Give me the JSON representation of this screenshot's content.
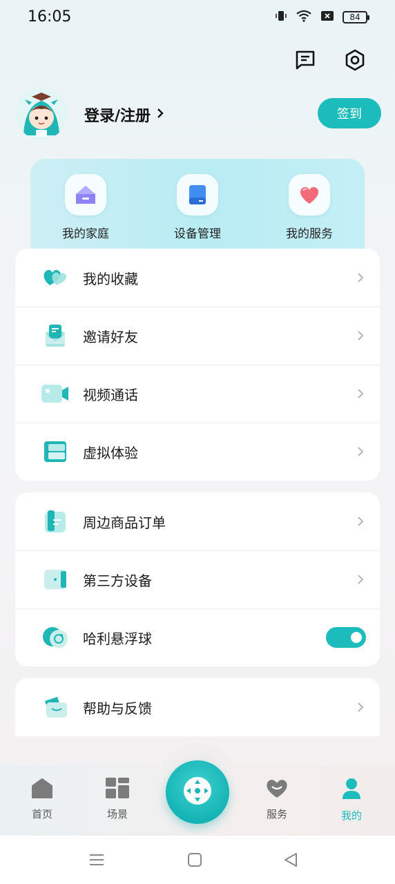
{
  "status_bar": {
    "time": "16:05",
    "battery": "84"
  },
  "header": {
    "message_icon": "message-icon",
    "settings_icon": "settings-icon"
  },
  "profile": {
    "login_label": "登录/注册",
    "checkin_label": "签到"
  },
  "quick_actions": [
    {
      "label": "我的家庭",
      "icon": "home-icon"
    },
    {
      "label": "设备管理",
      "icon": "device-icon"
    },
    {
      "label": "我的服务",
      "icon": "heart-icon"
    }
  ],
  "menu_group_1": [
    {
      "label": "我的收藏",
      "icon": "favorite-icon"
    },
    {
      "label": "邀请好友",
      "icon": "invite-icon"
    },
    {
      "label": "视频通话",
      "icon": "video-call-icon"
    },
    {
      "label": "虚拟体验",
      "icon": "virtual-experience-icon"
    }
  ],
  "menu_group_2": [
    {
      "label": "周边商品订单",
      "icon": "order-icon"
    },
    {
      "label": "第三方设备",
      "icon": "third-party-device-icon"
    },
    {
      "label": "哈利悬浮球",
      "icon": "floating-ball-icon",
      "toggle_on": true
    }
  ],
  "menu_group_3": [
    {
      "label": "帮助与反馈",
      "icon": "help-feedback-icon"
    }
  ],
  "bottom_nav": [
    {
      "label": "首页",
      "icon": "home-tab-icon"
    },
    {
      "label": "场景",
      "icon": "scene-tab-icon"
    },
    {
      "label": "服务",
      "icon": "service-tab-icon"
    },
    {
      "label": "我的",
      "icon": "profile-tab-icon",
      "active": true
    }
  ],
  "colors": {
    "accent": "#1cbcbd",
    "text": "#1b1b1b"
  }
}
